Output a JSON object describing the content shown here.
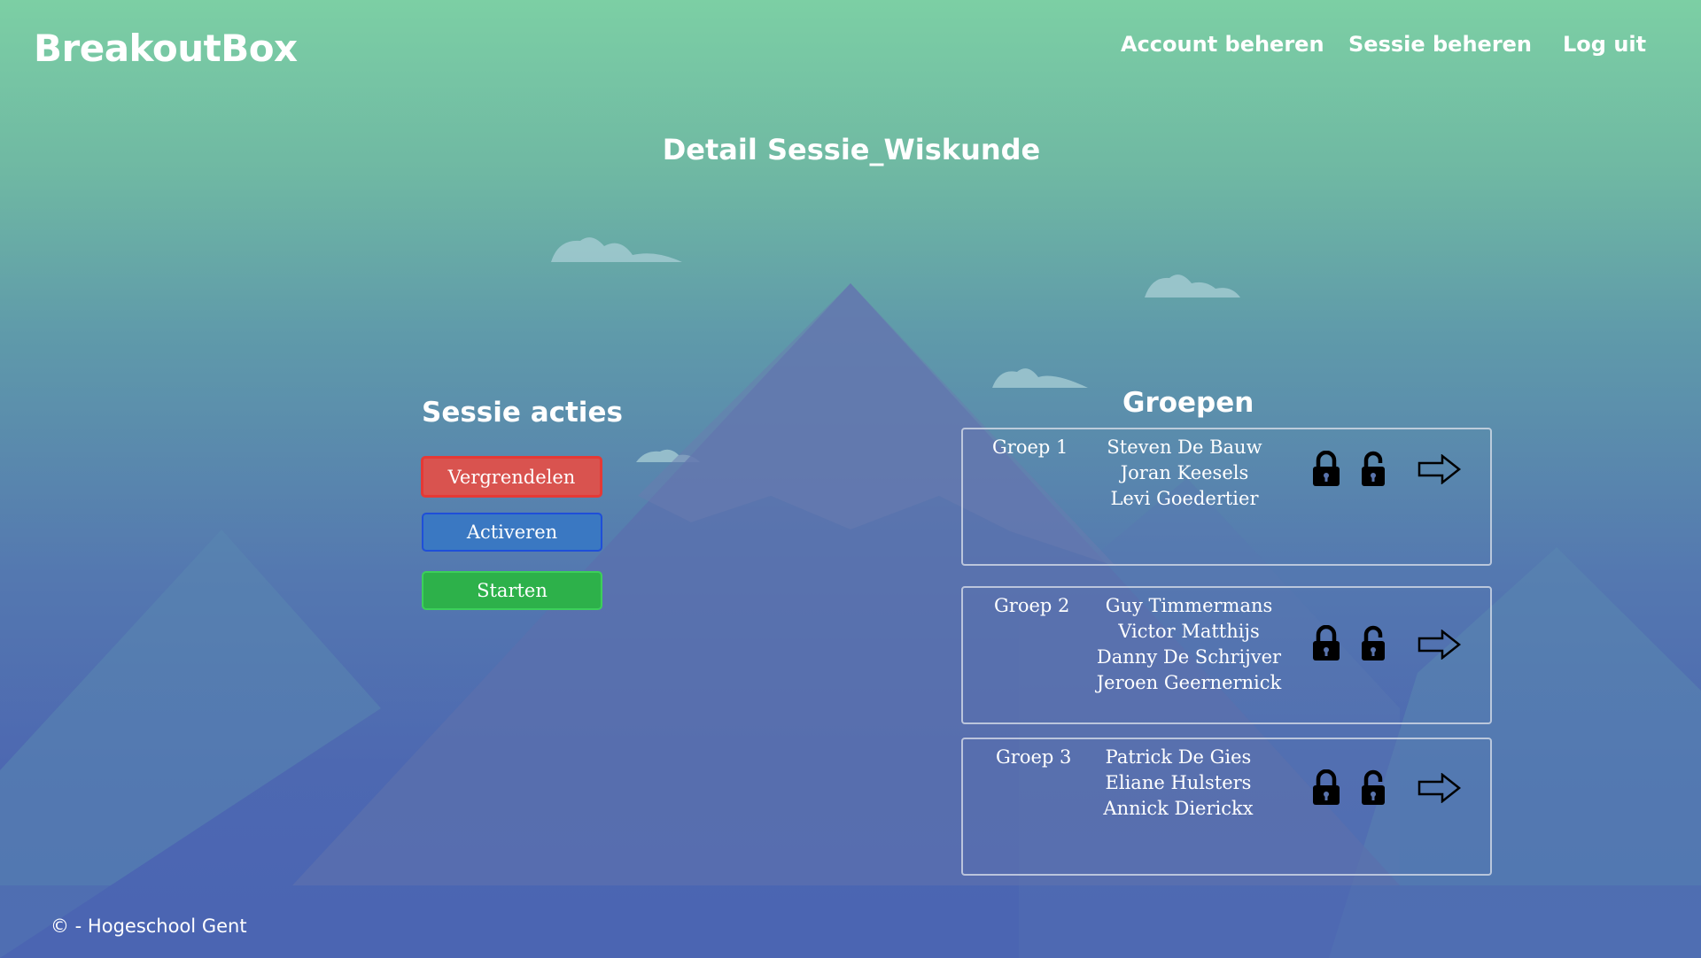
{
  "header": {
    "brand": "BreakoutBox",
    "nav": {
      "account": "Account beheren",
      "session": "Sessie beheren",
      "logout": "Log uit"
    }
  },
  "main": {
    "title": "Detail Sessie_Wiskunde",
    "actions": {
      "heading": "Sessie acties",
      "lock_label": "Vergrendelen",
      "activate_label": "Activeren",
      "start_label": "Starten"
    },
    "groups": {
      "heading": "Groepen",
      "items": [
        {
          "name": "Groep 1",
          "members": [
            "Steven De Bauw",
            "Joran Keesels",
            "Levi Goedertier"
          ]
        },
        {
          "name": "Groep 2",
          "members": [
            "Guy Timmermans",
            "Victor Matthijs",
            "Danny De Schrijver",
            "Jeroen Geernernick"
          ]
        },
        {
          "name": "Groep 3",
          "members": [
            "Patrick De Gies",
            "Eliane Hulsters",
            "Annick Dierickx"
          ]
        }
      ]
    }
  },
  "footer": {
    "text": "©  - Hogeschool Gent"
  },
  "icons": {
    "lock": "lock-icon",
    "unlock": "unlock-icon",
    "arrow": "arrow-right-icon"
  },
  "colors": {
    "lock_button": "#d9534f",
    "activate_button": "#3a78c2",
    "start_button": "#2db14a"
  }
}
